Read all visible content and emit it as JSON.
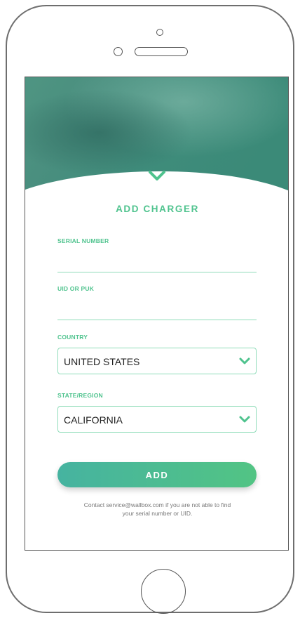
{
  "form": {
    "title": "ADD CHARGER",
    "serial": {
      "label": "SERIAL NUMBER",
      "value": ""
    },
    "uid": {
      "label": "UID OR PUK",
      "value": ""
    },
    "country": {
      "label": "COUNTRY",
      "value": "UNITED STATES"
    },
    "state": {
      "label": "STATE/REGION",
      "value": "CALIFORNIA"
    },
    "submit_label": "ADD",
    "note_line1": "Contact service@wallbox.com if you are not able to find",
    "note_line2": "your serial number or UID."
  },
  "colors": {
    "accent": "#4fc38e",
    "field_border": "#8fdcb9",
    "hero_teal": "#3f8f7c",
    "button_start": "#46b3a0",
    "button_end": "#52c484"
  },
  "icons": {
    "hero_chevron": "chevron-down-icon",
    "select_chevron": "chevron-down-icon"
  }
}
